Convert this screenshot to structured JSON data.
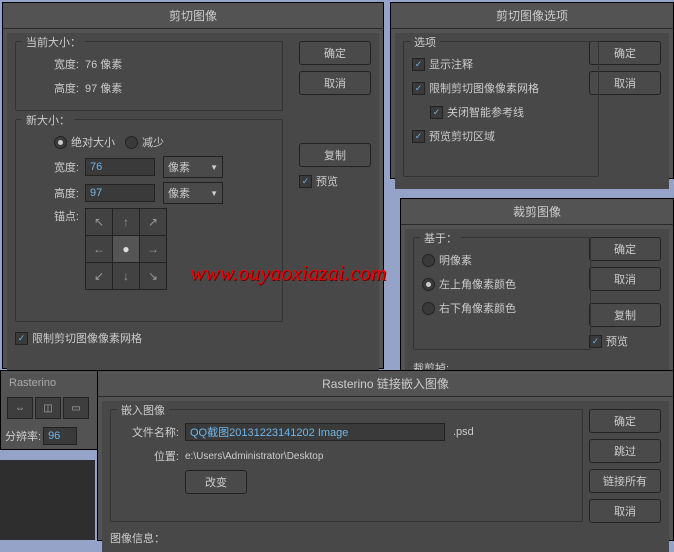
{
  "watermark": "www.ouyaoxiazai.com",
  "panel1": {
    "title": "剪切图像",
    "current_label": "当前大小：",
    "width_lbl": "宽度:",
    "width_val": "76 像素",
    "height_lbl": "高度:",
    "height_val": "97 像素",
    "new_label": "新大小：",
    "radio_abs": "绝对大小",
    "radio_dec": "减少",
    "w_lbl": "宽度:",
    "w_val": "76",
    "h_lbl": "高度:",
    "h_val": "97",
    "unit": "像素",
    "anchor_lbl": "锚点:",
    "constrain": "限制剪切图像像素网格",
    "btn_ok": "确定",
    "btn_cancel": "取消",
    "btn_copy": "复制",
    "chk_preview": "预览"
  },
  "panel2": {
    "title": "剪切图像选项",
    "options_label": "选项",
    "opt1": "显示注释",
    "opt2": "限制剪切图像像素网格",
    "opt3": "关闭智能参考线",
    "opt4": "预览剪切区域",
    "btn_ok": "确定",
    "btn_cancel": "取消"
  },
  "panel3": {
    "title": "裁剪图像",
    "based_label": "基于：",
    "r1": "明像素",
    "r2": "左上角像素颜色",
    "r3": "右下角像素颜色",
    "crop_label": "裁剪掉:",
    "btn_ok": "确定",
    "btn_cancel": "取消",
    "btn_copy": "复制",
    "chk_preview": "预览"
  },
  "panel4": {
    "title": "Rasterino 链接嵌入图像",
    "embed_label": "嵌入图像",
    "fname_lbl": "文件名称:",
    "fname_val": "QQ截图20131223141202 Image",
    "ext": ".psd",
    "loc_lbl": "位置:",
    "loc_val": "e:\\Users\\Administrator\\Desktop",
    "btn_change": "改变",
    "info_label": "图像信息：",
    "btn_ok": "确定",
    "btn_skip": "跳过",
    "btn_linkall": "链接所有",
    "btn_cancel": "取消"
  },
  "sidebar": {
    "title": "Rasterino",
    "res_lbl": "分辨率:",
    "res_val": "96"
  }
}
